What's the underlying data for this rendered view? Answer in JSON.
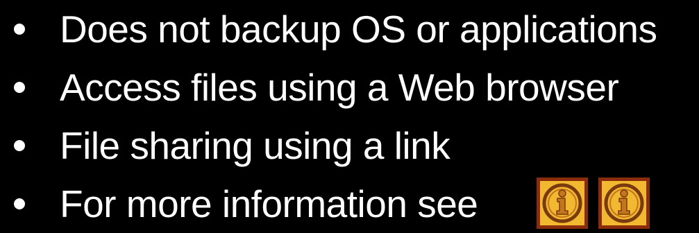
{
  "bullets": [
    "Does not backup OS or applications",
    "Access files using a Web browser",
    "File sharing using a link",
    "For more information see"
  ],
  "icons": [
    {
      "name": "info-icon",
      "glyph": "i"
    },
    {
      "name": "info-icon",
      "glyph": "i"
    }
  ],
  "colors": {
    "background": "#000000",
    "text": "#ffffff",
    "icon_frame": "#8b2c0c",
    "icon_fill": "#f1b830",
    "icon_ring": "#7a3a10",
    "icon_letter": "#c4761c"
  }
}
